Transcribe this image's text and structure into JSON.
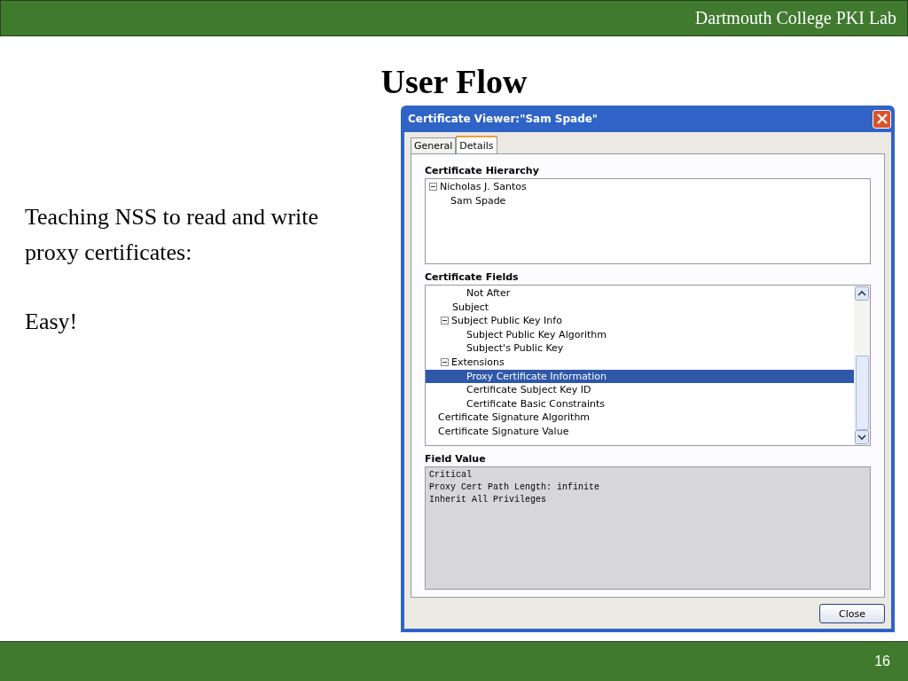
{
  "header": {
    "title": "Dartmouth College PKI Lab"
  },
  "slide_title": "User Flow",
  "body_text": [
    "Teaching NSS to read and write proxy certificates:",
    "Easy!"
  ],
  "dialog": {
    "title": "Certificate Viewer:\"Sam Spade\"",
    "tabs": [
      {
        "label": "General",
        "selected": false
      },
      {
        "label": "Details",
        "selected": true
      }
    ],
    "hierarchy_heading": "Certificate Hierarchy",
    "hierarchy": [
      {
        "label": "Nicholas J. Santos",
        "expanded": true,
        "selected": false,
        "children": [
          {
            "label": "Sam Spade",
            "selected": false
          }
        ]
      }
    ],
    "fields_heading": "Certificate Fields",
    "fields": [
      {
        "children": [
          {
            "children": [
              {
                "label": "Not After",
                "selected": false
              }
            ]
          },
          {
            "label": "Subject",
            "selected": false
          },
          {
            "label": "Subject Public Key Info",
            "expanded": true,
            "selected": false,
            "children": [
              {
                "label": "Subject Public Key Algorithm",
                "selected": false
              },
              {
                "label": "Subject's Public Key",
                "selected": false
              }
            ]
          },
          {
            "label": "Extensions",
            "expanded": true,
            "selected": false,
            "children": [
              {
                "label": "Proxy Certificate Information",
                "selected": true
              },
              {
                "label": "Certificate Subject Key ID",
                "selected": false
              },
              {
                "label": "Certificate Basic Constraints",
                "selected": false
              }
            ]
          }
        ]
      },
      {
        "label": "Certificate Signature Algorithm",
        "selected": false
      },
      {
        "label": "Certificate Signature Value",
        "selected": false
      }
    ],
    "field_value_heading": "Field Value",
    "field_value": [
      "Critical",
      "Proxy Cert Path Length: infinite",
      "Inherit All Privileges"
    ],
    "close_button": "Close"
  },
  "footer": {
    "page_number": "16"
  }
}
